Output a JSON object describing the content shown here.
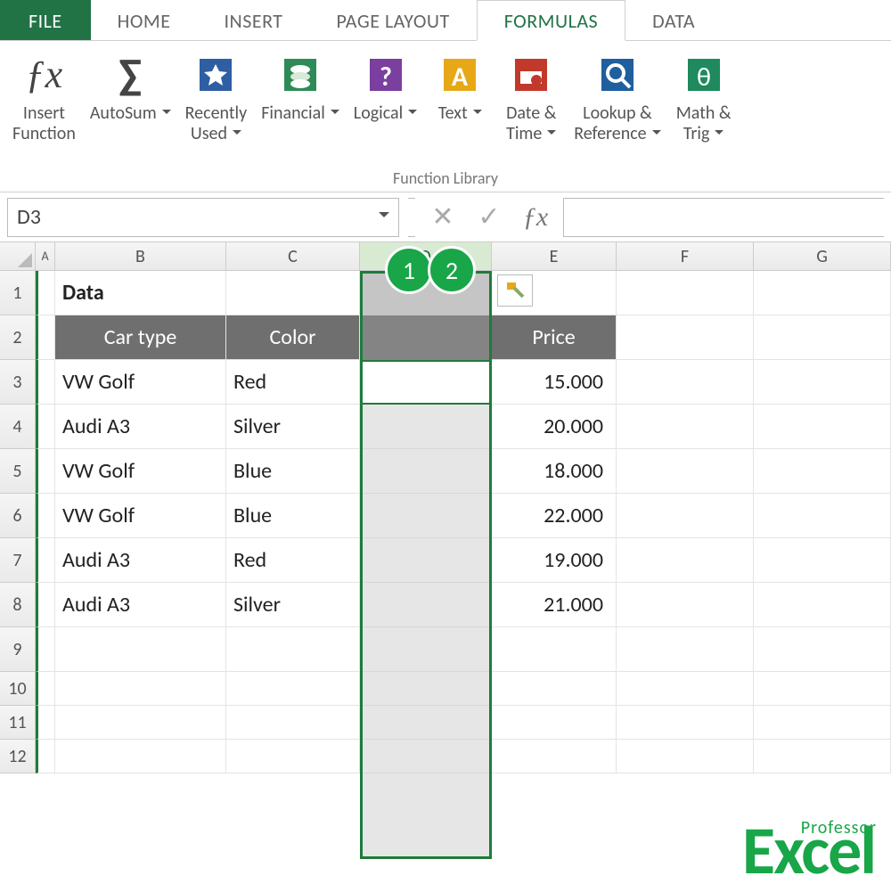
{
  "tabs": {
    "file": "FILE",
    "home": "HOME",
    "insert": "INSERT",
    "pagelayout": "PAGE LAYOUT",
    "formulas": "FORMULAS",
    "data": "DATA"
  },
  "ribbon": {
    "insert_function": "Insert\nFunction",
    "autosum": "AutoSum",
    "recently_used": "Recently\nUsed",
    "financial": "Financial",
    "logical": "Logical",
    "text": "Text",
    "date_time": "Date &\nTime",
    "lookup_ref": "Lookup &\nReference",
    "math_trig": "Math &\nTrig",
    "group_label": "Function Library"
  },
  "namebox": "D3",
  "callouts": {
    "one": "1",
    "two": "2"
  },
  "columns": {
    "A": "A",
    "B": "B",
    "C": "C",
    "D": "D",
    "E": "E",
    "F": "F",
    "G": "G"
  },
  "sheet": {
    "title_cell": "Data",
    "headers": {
      "car_type": "Car type",
      "color": "Color",
      "price": "Price"
    },
    "rows": [
      {
        "car": "VW Golf",
        "color": "Red",
        "price": "15.000"
      },
      {
        "car": "Audi A3",
        "color": "Silver",
        "price": "20.000"
      },
      {
        "car": "VW Golf",
        "color": "Blue",
        "price": "18.000"
      },
      {
        "car": "VW Golf",
        "color": "Blue",
        "price": "22.000"
      },
      {
        "car": "Audi A3",
        "color": "Red",
        "price": "19.000"
      },
      {
        "car": "Audi A3",
        "color": "Silver",
        "price": "21.000"
      }
    ]
  },
  "logo": {
    "prof": "Professor",
    "excel": "Excel"
  }
}
